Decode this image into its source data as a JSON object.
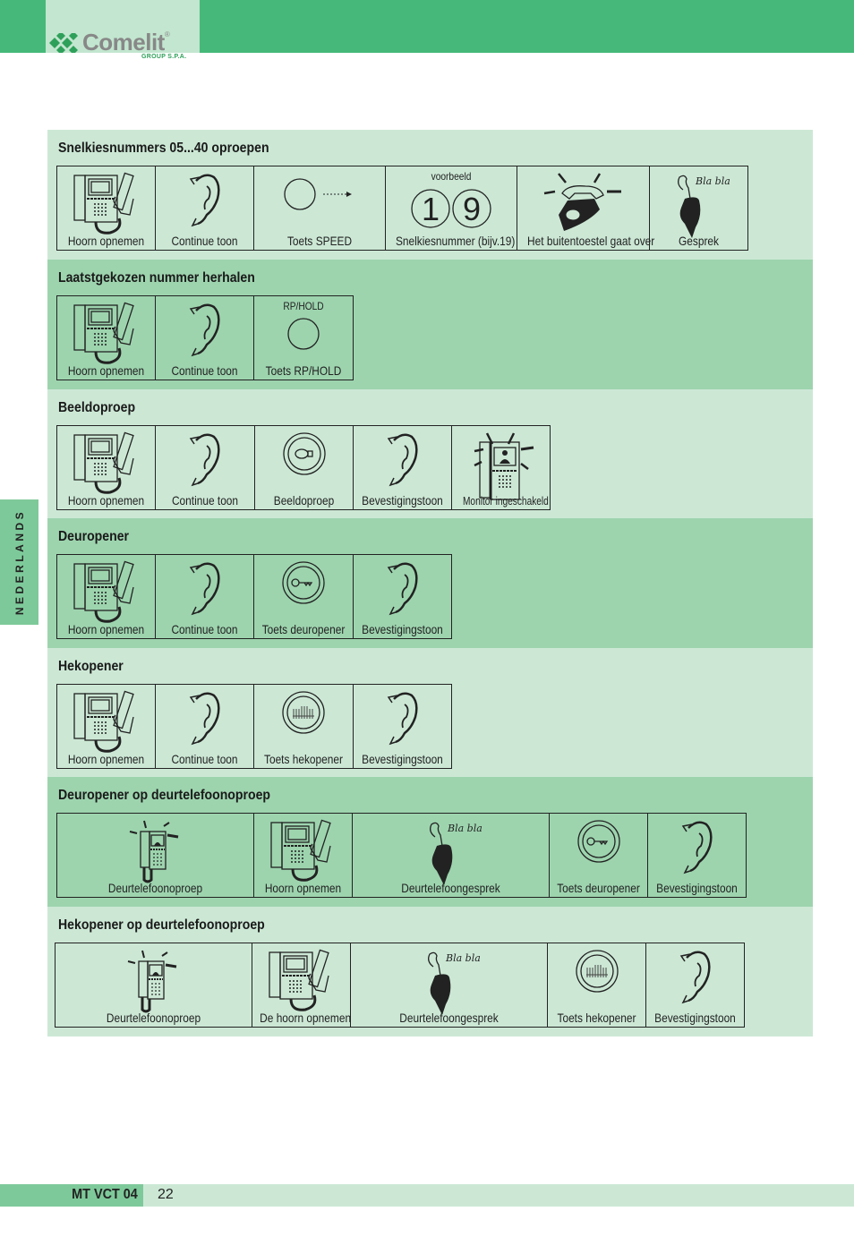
{
  "header": {
    "brand": "Comelit",
    "brand_mark": "®",
    "brand_sub": "GROUP S.P.A.",
    "colors": {
      "bar": "#46b97a",
      "logo_bg": "#c2e6cf",
      "section_light": "#cce8d5",
      "section_dark": "#9dd4ae",
      "tab": "#7ec99a"
    }
  },
  "side_tab": {
    "label": "NEDERLANDS"
  },
  "sections": [
    {
      "title": "Snelkiesnummers 05...40 oproepen",
      "steps": [
        {
          "icon": "monitor-handset-icon",
          "label": "Hoorn opnemen"
        },
        {
          "icon": "ear-icon",
          "label": "Continue toon"
        },
        {
          "icon": "speed-button-icon",
          "label": "Toets SPEED"
        },
        {
          "icon": "digits-icon",
          "sub": "voorbeeld",
          "digits": [
            "1",
            "9"
          ],
          "label": "Snelkiesnummer (bijv.19)"
        },
        {
          "icon": "ringing-phone-icon",
          "label": "Het buitentoestel gaat over"
        },
        {
          "icon": "talking-handset-icon",
          "label": "Gesprek",
          "bubble": "Bla bla"
        }
      ]
    },
    {
      "title": "Laatstgekozen nummer herhalen",
      "steps": [
        {
          "icon": "monitor-handset-icon",
          "label": "Hoorn opnemen"
        },
        {
          "icon": "ear-icon",
          "label": "Continue toon"
        },
        {
          "icon": "button-circle-icon",
          "sub": "RP/HOLD",
          "label": "Toets RP/HOLD"
        }
      ]
    },
    {
      "title": "Beeldoproep",
      "steps": [
        {
          "icon": "monitor-handset-icon",
          "label": "Hoorn opnemen"
        },
        {
          "icon": "ear-icon",
          "label": "Continue toon"
        },
        {
          "icon": "bulb-button-icon",
          "label": "Beeldoproep"
        },
        {
          "icon": "ear-icon",
          "label": "Bevestigingstoon"
        },
        {
          "icon": "monitor-on-icon",
          "label": "Monitor ingeschakeld"
        }
      ]
    },
    {
      "title": "Deuropener",
      "steps": [
        {
          "icon": "monitor-handset-icon",
          "label": "Hoorn opnemen"
        },
        {
          "icon": "ear-icon",
          "label": "Continue toon"
        },
        {
          "icon": "key-button-icon",
          "label": "Toets deuropener"
        },
        {
          "icon": "ear-icon",
          "label": "Bevestigingstoon"
        }
      ]
    },
    {
      "title": "Hekopener",
      "steps": [
        {
          "icon": "monitor-handset-icon",
          "label": "Hoorn opnemen"
        },
        {
          "icon": "ear-icon",
          "label": "Continue toon"
        },
        {
          "icon": "gate-button-icon",
          "label": "Toets hekopener"
        },
        {
          "icon": "ear-icon",
          "label": "Bevestigingstoon"
        }
      ]
    },
    {
      "title": "Deuropener op deurtelefoonoproep",
      "steps": [
        {
          "icon": "ringing-monitor-icon",
          "label": "Deurtelefoonoproep"
        },
        {
          "icon": "monitor-handset-icon",
          "label": "Hoorn opnemen"
        },
        {
          "icon": "talking-handset-icon",
          "label": "Deurtelefoongesprek",
          "bubble": "Bla bla"
        },
        {
          "icon": "key-button-icon",
          "label": "Toets deuropener"
        },
        {
          "icon": "ear-icon",
          "label": "Bevestigingstoon"
        }
      ]
    },
    {
      "title": "Hekopener op deurtelefoonoproep",
      "steps": [
        {
          "icon": "ringing-monitor-icon",
          "label": "Deurtelefoonoproep"
        },
        {
          "icon": "monitor-handset-icon",
          "label": "De hoorn opnemen"
        },
        {
          "icon": "talking-handset-icon",
          "label": "Deurtelefoongesprek",
          "bubble": "Bla bla"
        },
        {
          "icon": "gate-button-icon",
          "label": "Toets hekopener"
        },
        {
          "icon": "ear-icon",
          "label": "Bevestigingstoon"
        }
      ]
    }
  ],
  "footer": {
    "doc_code": "MT VCT 04",
    "page": "22"
  }
}
